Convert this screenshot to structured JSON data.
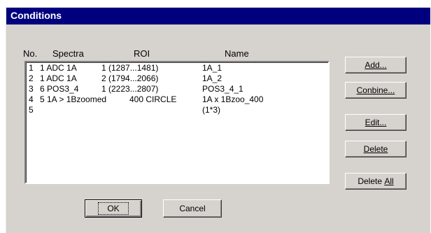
{
  "window": {
    "title": "Conditions"
  },
  "columns": {
    "no": "No.",
    "spectra": "Spectra",
    "roi": "ROI",
    "name": "Name"
  },
  "rows": [
    {
      "no": "1",
      "spectra": "1 ADC 1A",
      "roi": "1 (1287...1481)",
      "name": "1A_1"
    },
    {
      "no": "2",
      "spectra": "1 ADC 1A",
      "roi": "2 (1794...2066)",
      "name": "1A_2"
    },
    {
      "no": "3",
      "spectra": "6 POS3_4",
      "roi": "1 (2223...2807)",
      "name": "POS3_4_1"
    },
    {
      "no": "4",
      "spectra": "5 1A > 1Bzoomed",
      "roi": "400 CIRCLE",
      "name": "1A x 1Bzoo_400"
    },
    {
      "no": "5",
      "spectra": "",
      "roi": "",
      "name": "(1*3)"
    }
  ],
  "buttons": {
    "add": "Add...",
    "combine": "Conbine...",
    "edit": "Edit...",
    "delete": "Delete",
    "delete_all_prefix": "Delete ",
    "delete_all_underlined": "All",
    "ok": "OK",
    "cancel": "Cancel"
  },
  "colors": {
    "titlebar": "#00007f",
    "dialog_face": "#d6d3ce",
    "list_bg": "#ffffff"
  }
}
